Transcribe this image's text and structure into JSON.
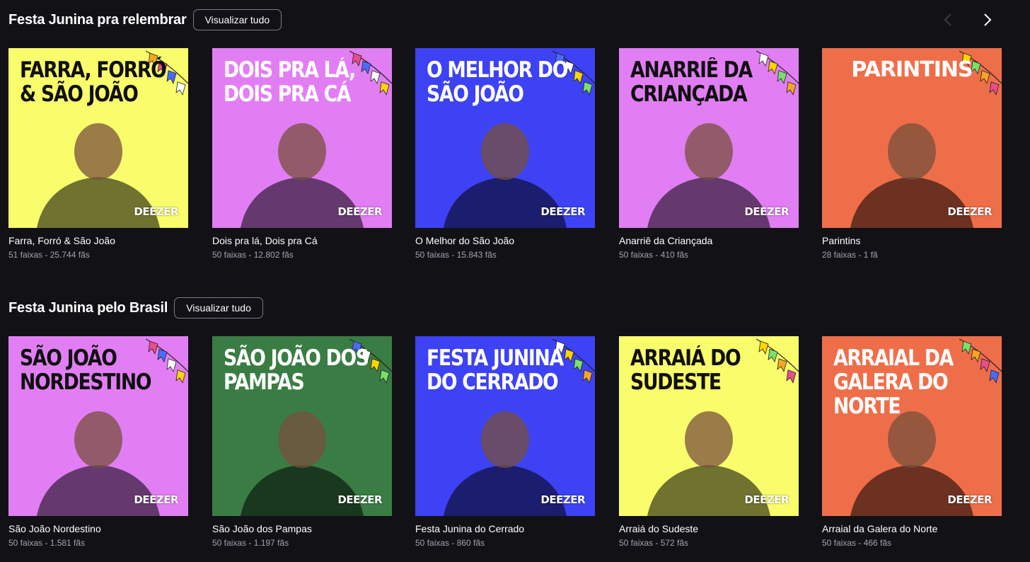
{
  "sections": [
    {
      "title": "Festa Junina pra relembrar",
      "view_all": "Visualizar tudo",
      "cards": [
        {
          "cover_text": "Farra, Forró & São João",
          "title": "Farra, Forró & São João",
          "meta": "51 faixas - 25.744 fãs",
          "bg": "#f9fd6b",
          "title_color": "dark"
        },
        {
          "cover_text": "Dois pra lá, Dois pra cá",
          "title": "Dois pra lá, Dois pra Cá",
          "meta": "50 faixas - 12.802 fãs",
          "bg": "#e27ef4",
          "title_color": "light"
        },
        {
          "cover_text": "O Melhor do São João",
          "title": "O Melhor do São João",
          "meta": "50 faixas - 15.843 fãs",
          "bg": "#3d42f4",
          "title_color": "light"
        },
        {
          "cover_text": "Anarriê da Criançada",
          "title": "Anarriê da Criançada",
          "meta": "50 faixas - 410 fãs",
          "bg": "#e27ef4",
          "title_color": "dark"
        },
        {
          "cover_text": "Parintins",
          "title": "Parintins",
          "meta": "28 faixas - 1 fã",
          "bg": "#ef6e4a",
          "title_color": "light"
        }
      ]
    },
    {
      "title": "Festa Junina pelo Brasil",
      "view_all": "Visualizar tudo",
      "cards": [
        {
          "cover_text": "São João Nordestino",
          "title": "São João Nordestino",
          "meta": "50 faixas - 1.581 fãs",
          "bg": "#e27ef4",
          "title_color": "dark"
        },
        {
          "cover_text": "São João dos Pampas",
          "title": "São João dos Pampas",
          "meta": "50 faixas - 1.197 fãs",
          "bg": "#3a7d44",
          "title_color": "light"
        },
        {
          "cover_text": "Festa Junina do Cerrado",
          "title": "Festa Junina do Cerrado",
          "meta": "50 faixas - 860 fãs",
          "bg": "#3d42f4",
          "title_color": "light"
        },
        {
          "cover_text": "Arraiá do Sudeste",
          "title": "Arraiá do Sudeste",
          "meta": "50 faixas - 572 fãs",
          "bg": "#f9fd6b",
          "title_color": "dark"
        },
        {
          "cover_text": "Arraial da Galera do Norte",
          "title": "Arraial da Galera do Norte",
          "meta": "50 faixas - 466 fãs",
          "bg": "#ef6e4a",
          "title_color": "light"
        }
      ]
    }
  ],
  "brand": "DEEZER",
  "icons": {
    "prev": "chevron-left-icon",
    "next": "chevron-right-icon"
  }
}
